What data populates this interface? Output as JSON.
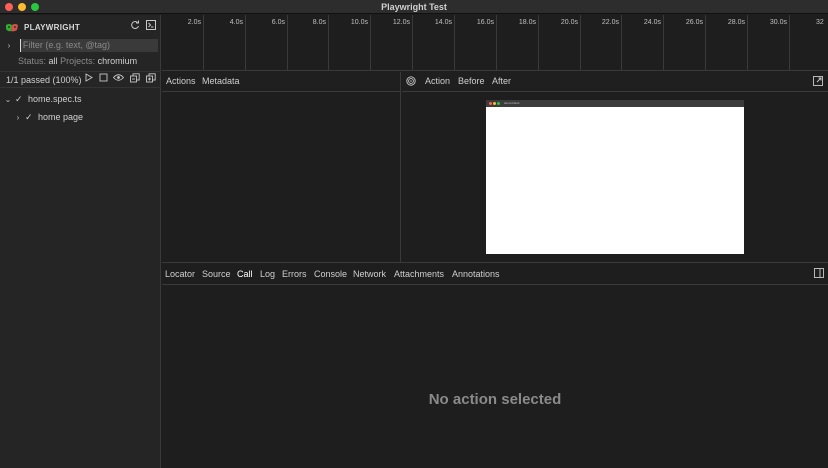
{
  "window": {
    "title": "Playwright Test"
  },
  "sidebar": {
    "brand": "PLAYWRIGHT",
    "filter_placeholder": "Filter (e.g. text, @tag)",
    "status_label": "Status:",
    "status_value": "all",
    "projects_label": "Projects:",
    "projects_value": "chromium",
    "passed_summary": "1/1 passed (100%)",
    "tree": [
      {
        "label": "home.spec.ts",
        "expanded": true,
        "status": "passed"
      },
      {
        "label": "home page",
        "expanded": false,
        "status": "passed"
      }
    ],
    "icons": {
      "reload": "reload-icon",
      "terminal": "terminal-icon",
      "run": "play-icon",
      "stop": "stop-icon",
      "watch": "eye-icon",
      "collapse": "collapse-all-icon",
      "expand": "expand-all-icon"
    }
  },
  "timeline": {
    "ticks": [
      "2.0s",
      "4.0s",
      "6.0s",
      "8.0s",
      "10.0s",
      "12.0s",
      "14.0s",
      "16.0s",
      "18.0s",
      "20.0s",
      "22.0s",
      "24.0s",
      "26.0s",
      "28.0s",
      "30.0s",
      "32"
    ]
  },
  "actions_pane": {
    "tabs": [
      "Actions",
      "Metadata"
    ]
  },
  "snapshot_pane": {
    "tabs": [
      "Action",
      "Before",
      "After"
    ],
    "address": "about:blank"
  },
  "bottom_panel": {
    "tabs": [
      "Locator",
      "Source",
      "Call",
      "Log",
      "Errors",
      "Console",
      "Network",
      "Attachments",
      "Annotations"
    ],
    "active_tab": "Call",
    "empty_message": "No action selected"
  },
  "colors": {
    "background": "#1e1e1e",
    "sidebar": "#252526",
    "close": "#ff5f57",
    "minimize": "#febc2e",
    "maximize": "#28c840",
    "brand_green": "#2ead33",
    "brand_red": "#d65348"
  }
}
